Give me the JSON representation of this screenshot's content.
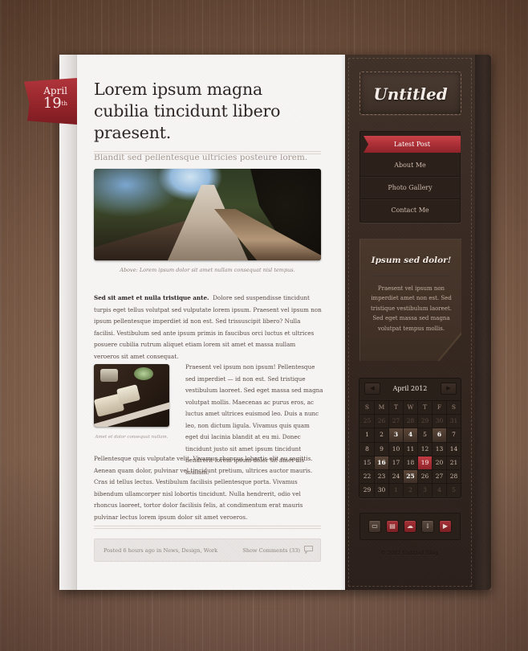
{
  "date_ribbon": {
    "month": "April",
    "day": "19",
    "suffix": "th"
  },
  "article": {
    "title": "Lorem ipsum magna cubilia tincidunt libero praesent.",
    "subtitle": "Blandit sed pellentesque ultricies posteure lorem.",
    "hero_caption": "Above: Lorem ipsum dolor sit amet nullam consequat nisl tempus.",
    "lead_bold": "Sed sit amet et nulla tristique ante.",
    "p1": "Dolore sed suspendisse tincidunt turpis eget tellus volutpat sed vulputate lorem ipsum. Praesent vel ipsum non ipsum pellentesque imperdiet id non est. Sed trissuscipit libero? Nulla facilisi. Vestibulum sed ante ipsum primis in faucibus orci luctus et ultrices posuere cubilia rutrum aliquet etiam lorem sit amet et massa nullam veroeros sit amet consequat.",
    "thumb_caption": "Amet et dolor consequat nullam.",
    "p2": "Praesent vel ipsum non ipsum! Pellentesque sed imperdiet — id non est. Sed tristique vestibulum laoreet. Sed eget massa sed magna volutpat mollis. Maecenas ac purus eros, ac luctus amet ultrices euismod leo. Duis a nunc leo, non dictum ligula. Vivamus quis quam eget dui lacinia blandit at eu mi. Donec tincidunt justo sit amet ipsum tincidunt hendrerit lorem ipsum dolor sit amet nis lnullam.",
    "p3": "Pellentesque quis vulputate velit. Vivamus rhoncus lobortis elit eu sagittis. Aenean quam dolor, pulvinar vel tincidunt pretium, ultrices auctor mauris. Cras id tellus lectus. Vestibulum facilisis pellentesque porta. Vivamus bibendum ullamcorper nisl lobortis tincidunt. Nulla hendrerit, odio vel rhoncus laoreet, tortor dolor facilisis felis, at condimentum erat mauris pulvinar lectus lorem ipsum dolor sit amet veroeros.",
    "meta": {
      "posted_prefix": "Posted 6 hours ago in",
      "categories": [
        "News",
        "Design",
        "Work"
      ],
      "comments_label": "Show Comments (33)"
    }
  },
  "sidebar": {
    "logo": "Untitled",
    "nav": [
      {
        "label": "Latest Post",
        "active": true
      },
      {
        "label": "About Me",
        "active": false
      },
      {
        "label": "Photo Gallery",
        "active": false
      },
      {
        "label": "Contact Me",
        "active": false
      }
    ],
    "note": {
      "title": "Ipsum sed dolor!",
      "body": "Praesent vel ipsum non imperdiet amet non est. Sed tristique vestibulum laoreet. Sed eget massa sed magna volutpat tempus mollis."
    },
    "calendar": {
      "title": "April 2012",
      "prev_icon": "triangle-left-icon",
      "next_icon": "triangle-right-icon",
      "weekdays": [
        "S",
        "M",
        "T",
        "W",
        "T",
        "F",
        "S"
      ],
      "weeks": [
        [
          {
            "d": "25",
            "m": true
          },
          {
            "d": "26",
            "m": true
          },
          {
            "d": "27",
            "m": true
          },
          {
            "d": "28",
            "m": true
          },
          {
            "d": "29",
            "m": true
          },
          {
            "d": "30",
            "m": true
          },
          {
            "d": "31",
            "m": true
          }
        ],
        [
          {
            "d": "1"
          },
          {
            "d": "2"
          },
          {
            "d": "3",
            "e": true
          },
          {
            "d": "4",
            "e": true
          },
          {
            "d": "5"
          },
          {
            "d": "6",
            "e": true
          },
          {
            "d": "7"
          }
        ],
        [
          {
            "d": "8"
          },
          {
            "d": "9"
          },
          {
            "d": "10"
          },
          {
            "d": "11"
          },
          {
            "d": "12"
          },
          {
            "d": "13"
          },
          {
            "d": "14"
          }
        ],
        [
          {
            "d": "15"
          },
          {
            "d": "16",
            "e": true
          },
          {
            "d": "17"
          },
          {
            "d": "18"
          },
          {
            "d": "19",
            "t": true
          },
          {
            "d": "20"
          },
          {
            "d": "21"
          }
        ],
        [
          {
            "d": "22"
          },
          {
            "d": "23"
          },
          {
            "d": "24"
          },
          {
            "d": "25",
            "e": true
          },
          {
            "d": "26"
          },
          {
            "d": "27"
          },
          {
            "d": "28"
          }
        ],
        [
          {
            "d": "29"
          },
          {
            "d": "30"
          },
          {
            "d": "1",
            "m": true
          },
          {
            "d": "2",
            "m": true
          },
          {
            "d": "3",
            "m": true
          },
          {
            "d": "4",
            "m": true
          },
          {
            "d": "5",
            "m": true
          }
        ]
      ]
    },
    "social": [
      {
        "name": "chat-icon",
        "glyph": "▭",
        "style": "dark"
      },
      {
        "name": "feed-icon",
        "glyph": "▤",
        "style": "red"
      },
      {
        "name": "cloud-icon",
        "glyph": "☁",
        "style": "red"
      },
      {
        "name": "download-icon",
        "glyph": "↓",
        "style": "dark"
      },
      {
        "name": "play-icon",
        "glyph": "▶",
        "style": "red"
      }
    ],
    "copyright": "© 2012 Untitled Blog."
  },
  "colors": {
    "accent_red": "#a92e35",
    "leather": "#33261f",
    "paper": "#f6f5f4"
  }
}
